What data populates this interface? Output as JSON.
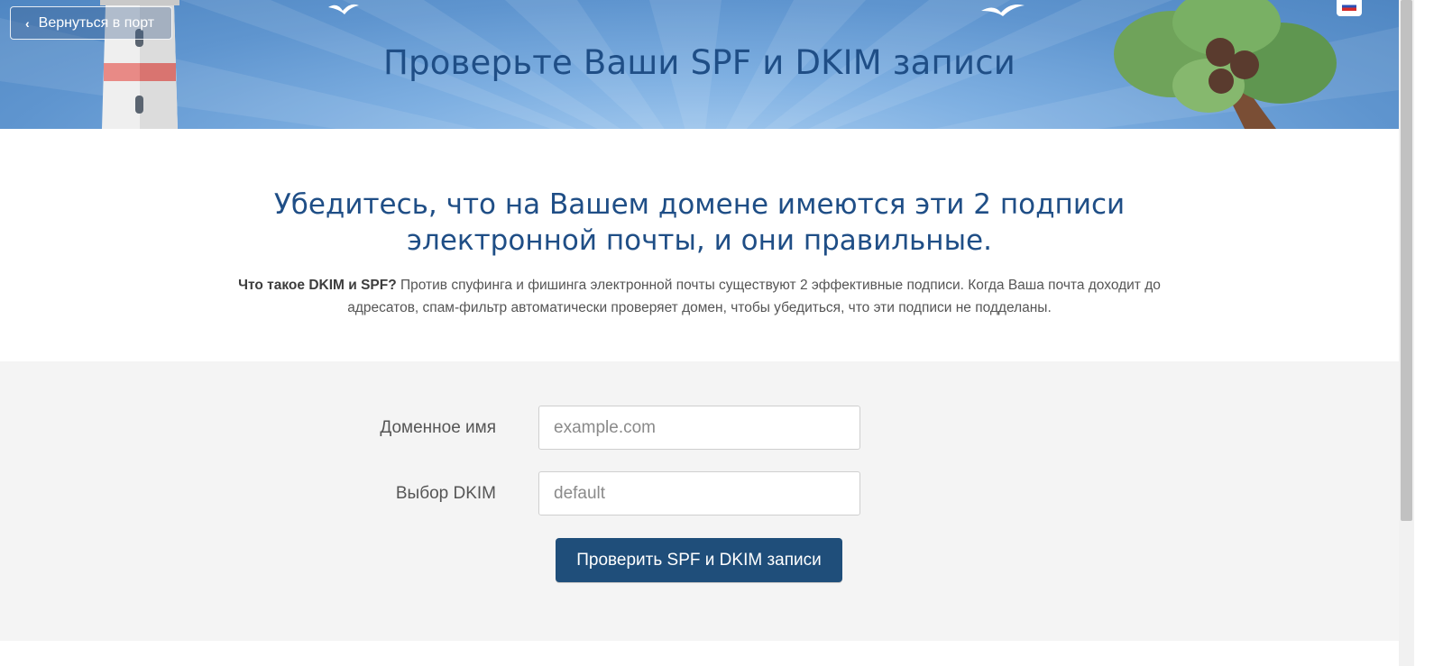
{
  "hero": {
    "title": "Проверьте Ваши SPF и DKIM записи",
    "back_label": "Вернуться в порт",
    "language_flag": "ru-flag-icon"
  },
  "intro": {
    "heading": "Убедитесь, что на Вашем домене имеются эти 2 подписи электронной почты, и они правильные.",
    "question": "Что такое DKIM и SPF?",
    "description": " Против спуфинга и фишинга электронной почты существуют 2 эффективные подписи. Когда Ваша почта доходит до адресатов, спам-фильтр автоматически проверяет домен, чтобы убедиться, что эти подписи не подделаны."
  },
  "form": {
    "domain_label": "Доменное имя",
    "domain_placeholder": "example.com",
    "selector_label": "Выбор DKIM",
    "selector_placeholder": "default",
    "submit_label": "Проверить SPF и DKIM записи"
  },
  "colors": {
    "accent": "#1f4e86",
    "button": "#1f4e7a",
    "form_bg": "#f4f4f4"
  }
}
